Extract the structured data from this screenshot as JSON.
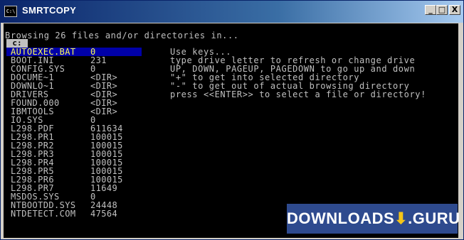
{
  "window": {
    "title": "SMRTCOPY",
    "icon_label": "C:\\",
    "buttons": {
      "minimize": "_",
      "maximize": "□",
      "close": "X"
    }
  },
  "console": {
    "header": "Browsing 26 files and/or directories in...",
    "drive": "c:",
    "files": [
      {
        "name": "AUTOEXEC.BAT",
        "size": "0",
        "selected": true
      },
      {
        "name": "BOOT.INI",
        "size": "231"
      },
      {
        "name": "CONFIG.SYS",
        "size": "0"
      },
      {
        "name": "DOCUME~1",
        "size": "<DIR>"
      },
      {
        "name": "DOWNLO~1",
        "size": "<DIR>"
      },
      {
        "name": "DRIVERS",
        "size": "<DIR>"
      },
      {
        "name": "FOUND.000",
        "size": "<DIR>"
      },
      {
        "name": "IBMTOOLS",
        "size": "<DIR>"
      },
      {
        "name": "IO.SYS",
        "size": "0"
      },
      {
        "name": "L298.PDF",
        "size": "611634"
      },
      {
        "name": "L298.PR1",
        "size": "100015"
      },
      {
        "name": "L298.PR2",
        "size": "100015"
      },
      {
        "name": "L298.PR3",
        "size": "100015"
      },
      {
        "name": "L298.PR4",
        "size": "100015"
      },
      {
        "name": "L298.PR5",
        "size": "100015"
      },
      {
        "name": "L298.PR6",
        "size": "100015"
      },
      {
        "name": "L298.PR7",
        "size": "11649"
      },
      {
        "name": "MSDOS.SYS",
        "size": "0"
      },
      {
        "name": "NTBOOTDD.SYS",
        "size": "24448"
      },
      {
        "name": "NTDETECT.COM",
        "size": "47564"
      }
    ],
    "keys": [
      "Use keys...",
      "type drive letter to refresh or change drive",
      "UP, DOWN, PAGEUP, PAGEDOWN to go up and down",
      "\"+\" to get into selected directory",
      "\"-\" to get out of actual browsing directory",
      "press <<ENTER>> to select a file or directory!"
    ]
  },
  "watermark": {
    "text": "DOWNLOADS",
    "arrow": "⬇",
    "suffix": ".GURU"
  }
}
